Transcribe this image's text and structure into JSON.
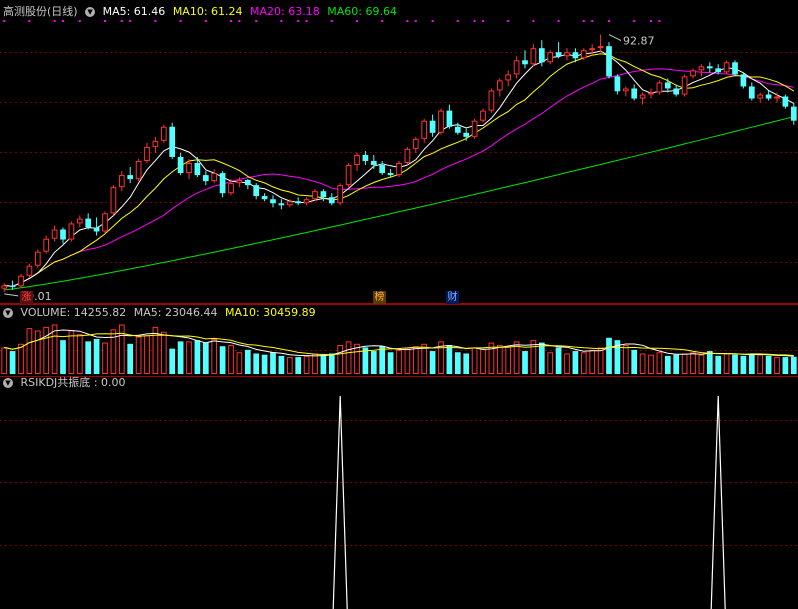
{
  "main_panel": {
    "stock_name": "高测股份(日线)",
    "ma5_label": "MA5: 61.46",
    "ma10_label": "MA10: 61.24",
    "ma20_label": "MA20: 63.18",
    "ma60_label": "MA60: 69.64",
    "high_annotation": "92.87",
    "low_annotation": "29.01",
    "event_markers": [
      "涨",
      "榜",
      "财"
    ]
  },
  "volume_panel": {
    "volume_label": "VOLUME: 14255.82",
    "ma5_label": "MA5: 23046.44",
    "ma10_label": "MA10: 30459.89"
  },
  "indicator_panel": {
    "title": "RSIKDJ共振底",
    "value": ": 0.00"
  },
  "colors": {
    "up": "#ff3232",
    "down": "#54ffff",
    "ma5": "#ffffff",
    "ma10": "#ffff00",
    "ma20": "#ff00ff",
    "ma60": "#00e600",
    "grid": "#800000",
    "text": "#c8c8c8",
    "signal": "#ffffff"
  },
  "chart_data": [
    {
      "type": "candlestick",
      "price_range": [
        26,
        96
      ],
      "max_point": {
        "index": 72,
        "value": 92.87
      },
      "min_point": {
        "index": 0,
        "value": 29.01
      },
      "candles": [
        [
          29.8,
          31.2,
          29.01,
          30.6
        ],
        [
          30.6,
          31.8,
          29.5,
          30.2
        ],
        [
          30.4,
          33.5,
          30.0,
          33.0
        ],
        [
          33.0,
          36.0,
          32.5,
          35.5
        ],
        [
          35.5,
          39.5,
          35.0,
          39.0
        ],
        [
          39.0,
          43.0,
          38.5,
          42.2
        ],
        [
          42.2,
          45.5,
          41.5,
          44.5
        ],
        [
          44.5,
          45.0,
          41.0,
          42.0
        ],
        [
          42.0,
          46.5,
          41.5,
          46.0
        ],
        [
          46.0,
          48.0,
          45.0,
          47.2
        ],
        [
          47.2,
          48.5,
          44.5,
          45.0
        ],
        [
          45.0,
          47.5,
          43.0,
          44.0
        ],
        [
          44.0,
          49.0,
          43.5,
          48.5
        ],
        [
          48.5,
          55.5,
          48.0,
          55.0
        ],
        [
          55.0,
          59.0,
          54.0,
          58.0
        ],
        [
          58.0,
          60.0,
          56.0,
          57.0
        ],
        [
          57.0,
          62.0,
          56.5,
          61.5
        ],
        [
          61.5,
          66.0,
          61.0,
          65.0
        ],
        [
          65.0,
          67.5,
          63.5,
          66.5
        ],
        [
          66.5,
          70.5,
          66.0,
          70.0
        ],
        [
          70.0,
          71.0,
          62.0,
          62.5
        ],
        [
          62.5,
          63.5,
          58.0,
          58.5
        ],
        [
          58.5,
          62.0,
          57.0,
          61.0
        ],
        [
          61.0,
          62.5,
          57.5,
          58.0
        ],
        [
          58.0,
          59.0,
          55.5,
          56.5
        ],
        [
          56.5,
          59.5,
          56.0,
          58.5
        ],
        [
          58.5,
          59.0,
          52.5,
          53.5
        ],
        [
          53.5,
          57.0,
          53.0,
          56.0
        ],
        [
          56.0,
          57.5,
          55.0,
          56.8
        ],
        [
          56.8,
          57.0,
          54.5,
          55.5
        ],
        [
          55.5,
          56.0,
          52.0,
          52.8
        ],
        [
          52.8,
          53.5,
          51.5,
          52.0
        ],
        [
          52.0,
          53.0,
          50.0,
          51.0
        ],
        [
          51.0,
          52.0,
          49.5,
          50.5
        ],
        [
          50.5,
          52.0,
          50.0,
          51.5
        ],
        [
          51.5,
          52.5,
          50.5,
          51.0
        ],
        [
          51.0,
          52.5,
          50.5,
          52.0
        ],
        [
          52.0,
          54.5,
          51.5,
          54.0
        ],
        [
          54.0,
          54.5,
          51.5,
          52.5
        ],
        [
          52.5,
          53.5,
          50.5,
          51.0
        ],
        [
          51.0,
          56.0,
          50.5,
          55.5
        ],
        [
          55.5,
          61.0,
          55.0,
          60.5
        ],
        [
          60.5,
          63.5,
          59.0,
          63.0
        ],
        [
          63.0,
          64.0,
          60.5,
          61.5
        ],
        [
          61.5,
          63.0,
          59.5,
          60.5
        ],
        [
          60.5,
          61.5,
          58.0,
          58.5
        ],
        [
          58.5,
          59.5,
          57.5,
          58.0
        ],
        [
          58.0,
          61.5,
          57.5,
          61.0
        ],
        [
          61.0,
          65.0,
          60.5,
          64.5
        ],
        [
          64.5,
          67.5,
          63.5,
          67.0
        ],
        [
          67.0,
          72.0,
          66.0,
          71.5
        ],
        [
          71.5,
          73.0,
          67.5,
          68.5
        ],
        [
          68.5,
          74.5,
          68.0,
          74.0
        ],
        [
          74.0,
          75.5,
          69.5,
          70.0
        ],
        [
          70.0,
          71.0,
          68.0,
          68.5
        ],
        [
          68.5,
          69.5,
          66.5,
          67.5
        ],
        [
          67.5,
          72.0,
          67.0,
          71.5
        ],
        [
          71.5,
          74.5,
          71.0,
          74.0
        ],
        [
          74.0,
          79.5,
          73.5,
          79.0
        ],
        [
          79.0,
          82.0,
          77.5,
          81.5
        ],
        [
          81.5,
          84.0,
          80.0,
          83.0
        ],
        [
          83.0,
          87.5,
          82.0,
          86.5
        ],
        [
          86.5,
          89.0,
          84.5,
          85.5
        ],
        [
          85.5,
          90.5,
          85.0,
          89.5
        ],
        [
          89.5,
          91.5,
          85.0,
          86.0
        ],
        [
          86.0,
          89.0,
          85.5,
          88.5
        ],
        [
          88.5,
          91.0,
          87.0,
          87.5
        ],
        [
          87.5,
          89.5,
          86.5,
          88.5
        ],
        [
          88.5,
          89.5,
          86.0,
          87.0
        ],
        [
          87.0,
          89.5,
          86.5,
          89.0
        ],
        [
          89.0,
          90.5,
          87.5,
          89.5
        ],
        [
          89.5,
          92.87,
          88.5,
          90.0
        ],
        [
          90.0,
          91.0,
          82.0,
          82.5
        ],
        [
          82.5,
          83.0,
          78.0,
          78.8
        ],
        [
          78.8,
          80.0,
          77.5,
          79.5
        ],
        [
          79.5,
          80.5,
          76.5,
          77.0
        ],
        [
          77.0,
          78.5,
          75.5,
          78.0
        ],
        [
          78.0,
          79.5,
          77.0,
          78.5
        ],
        [
          78.5,
          81.5,
          78.0,
          81.0
        ],
        [
          81.0,
          82.0,
          78.5,
          79.5
        ],
        [
          79.5,
          80.5,
          77.5,
          78.0
        ],
        [
          78.0,
          83.0,
          77.5,
          82.5
        ],
        [
          82.5,
          84.5,
          82.0,
          84.0
        ],
        [
          84.0,
          85.5,
          82.5,
          85.0
        ],
        [
          85.0,
          86.0,
          83.5,
          84.5
        ],
        [
          84.5,
          85.5,
          83.0,
          83.5
        ],
        [
          83.5,
          86.5,
          83.0,
          86.0
        ],
        [
          86.0,
          86.5,
          82.5,
          83.0
        ],
        [
          83.0,
          83.5,
          79.5,
          80.0
        ],
        [
          80.0,
          81.0,
          76.5,
          77.0
        ],
        [
          77.0,
          78.5,
          76.0,
          78.0
        ],
        [
          78.0,
          79.0,
          76.5,
          77.0
        ],
        [
          77.0,
          78.5,
          76.0,
          77.5
        ],
        [
          77.5,
          78.0,
          74.5,
          75.0
        ],
        [
          75.0,
          76.0,
          70.5,
          71.5
        ]
      ]
    },
    {
      "type": "bar",
      "series_name": "VOLUME",
      "values": [
        22000,
        19000,
        25000,
        38000,
        36000,
        39000,
        41000,
        28000,
        36000,
        33000,
        27000,
        29000,
        26000,
        37000,
        41000,
        25000,
        31000,
        32000,
        39000,
        35000,
        21000,
        27000,
        27000,
        28000,
        26000,
        29000,
        23000,
        24000,
        18000,
        20000,
        17000,
        16000,
        18000,
        15000,
        14000,
        14000,
        15000,
        17000,
        16000,
        17000,
        24000,
        27000,
        25000,
        22000,
        19000,
        23000,
        18000,
        20000,
        21000,
        23000,
        25000,
        19000,
        27000,
        24000,
        18000,
        17000,
        22000,
        21000,
        26000,
        24000,
        23000,
        27000,
        19000,
        28000,
        26000,
        18000,
        22000,
        17000,
        19000,
        18000,
        20000,
        22000,
        30000,
        28000,
        24000,
        20000,
        17000,
        16000,
        18000,
        15000,
        16000,
        17000,
        18000,
        16000,
        19000,
        15000,
        17000,
        16000,
        15000,
        17000,
        16000,
        15000,
        14000,
        14000,
        14255.82
      ],
      "ma_labels": [
        "MA5",
        "MA10"
      ]
    },
    {
      "type": "line",
      "series_name": "RSIKDJ共振底",
      "y_range": [
        0,
        1
      ],
      "signal_indices": [
        40,
        85
      ]
    }
  ]
}
